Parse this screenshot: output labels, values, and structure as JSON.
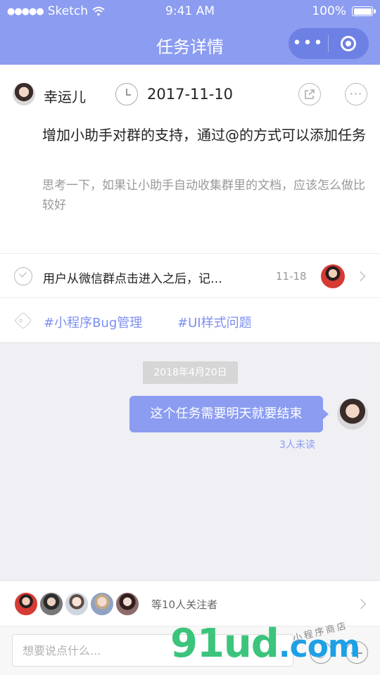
{
  "status_bar": {
    "carrier": "Sketch",
    "time": "9:41 AM",
    "battery": "100%",
    "battery_level": 1.0
  },
  "nav": {
    "title": "任务详情",
    "more_glyph": "•••",
    "background_color": "#8b9cf1"
  },
  "task": {
    "owner_name": "幸运儿",
    "due_date": "2017-11-10",
    "title": "增加小助手对群的支持，通过@的方式可以添加任务",
    "description": "思考一下，如果让小助手自动收集群里的文档，应该怎么做比较好"
  },
  "subtask": {
    "text": "用户从微信群点击进入之后，记…",
    "date": "11-18"
  },
  "tags": [
    "#小程序Bug管理",
    "#UI样式问题"
  ],
  "chat": {
    "date_divider": "2018年4月20日",
    "message": "这个任务需要明天就要结束",
    "read_status": "3人未读"
  },
  "followers": {
    "text": "等10人关注者",
    "avatar_count": 5
  },
  "input": {
    "placeholder": "想要说点什么..."
  },
  "watermark": {
    "text_green": "91ud",
    "text_blue": ".com",
    "tag": "小程序商店"
  },
  "icons": [
    "wifi-icon",
    "battery-icon",
    "more-icon",
    "target-icon",
    "clock-icon",
    "share-icon",
    "ellipsis-icon",
    "check-circle-icon",
    "chevron-right-icon",
    "tag-icon",
    "emoji-icon",
    "plus-icon"
  ]
}
